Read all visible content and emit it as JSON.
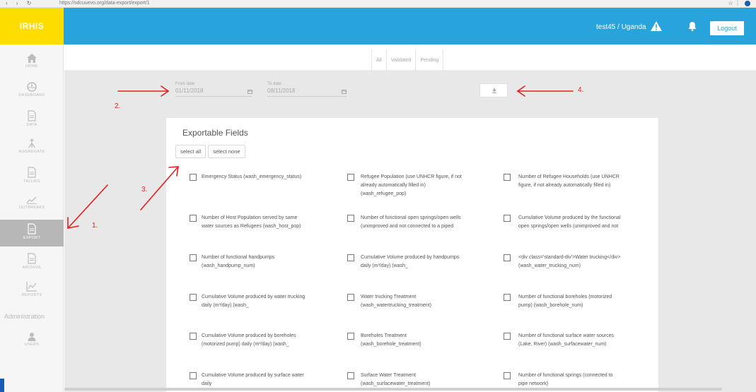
{
  "browser": {
    "nav_icons": "‹ › ↻",
    "url": "https://sdcuuevo.org/data-export/export/1",
    "right_icons": "☆ ⋮"
  },
  "header": {
    "brand": "IRHIS",
    "user": "test45 / Uganda",
    "logout": "Logout",
    "color": "#29a3dc",
    "brand_color": "#fddc00"
  },
  "sidebar": {
    "items": [
      {
        "label": "HOME",
        "icon": "home-icon"
      },
      {
        "label": "DASHBOARD",
        "icon": "dashboard-icon"
      },
      {
        "label": "DATA",
        "icon": "document-icon"
      },
      {
        "label": "AGGREGATE",
        "icon": "aggregate-icon"
      },
      {
        "label": "TALLIES",
        "icon": "document-icon"
      },
      {
        "label": "OUTBREAKS",
        "icon": "chart-icon"
      },
      {
        "label": "EXPORT",
        "icon": "export-icon"
      },
      {
        "label": "ARCHIVE",
        "icon": "archive-icon"
      },
      {
        "label": "REPORTS",
        "icon": "reports-icon"
      }
    ],
    "active": "EXPORT",
    "admin_label": "Administration",
    "users_label": "USERS"
  },
  "tabs": [
    "All",
    "Validated",
    "Pending"
  ],
  "filters": {
    "from_label": "From date",
    "from_value": "01/11/2018",
    "to_label": "To date",
    "to_value": "08/11/2018"
  },
  "export_card": {
    "title": "Exportable Fields",
    "select_all": "select all",
    "select_none": "select none",
    "fields": [
      "Emergency Status (wash_emergency_status)",
      "Refugee Population (use UNHCR figure, if not already automatically filled in) (wash_refugee_pop)",
      "Number of Refugee Households (use UNHCR figure, if not already automatically filled in)",
      "Number of Host Population served by same water sources as Refugees (wash_host_pop)",
      "Number of functional open springs/open wells (unimproved and not connected to a piped",
      "Cumulative Volume produced by the functional open springs/open wells (unimproved and not",
      "Number of functional handpumps (wash_handpump_num)",
      "Cumulative Volume produced by handpumps daily (m³/day) (wash_",
      "<div class='standard-div'>Water trucking</div> (wash_water_trucking_num)",
      "Cumulative Volume produced by water trucking daily (m³/day) (wash_",
      "Water trucking Treatment (wash_watertrucking_treatment)",
      "Number of functional boreholes (motorized pump) (wash_borehole_num)",
      "Cumulative Volume produced by boreholes (motorized pump) daily (m³/day) (wash_",
      "Boreholes Treatment (wash_borehole_treatment)",
      "Number of functional surface water sources (Lake, River) (wash_surfacewater_num)",
      "Cumulative Volume produced by surface water daily",
      "Surface Water Treatment (wash_surfacewater_treatment)",
      "Number of functional springs (connected to pipe network)"
    ]
  },
  "annotations": {
    "n1": "1.",
    "n2": "2.",
    "n3": "3.",
    "n4": "4.",
    "color": "#e02020"
  }
}
